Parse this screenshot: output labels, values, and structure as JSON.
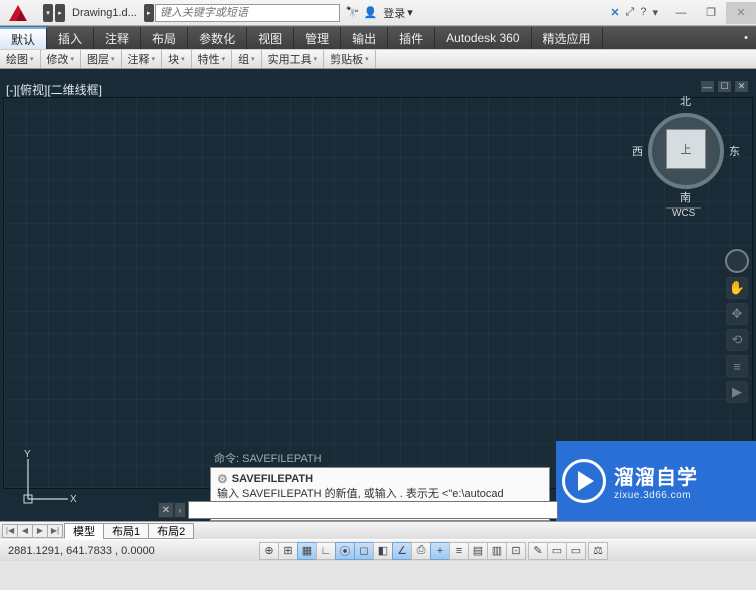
{
  "titlebar": {
    "doc_title": "Drawing1.d...",
    "search_placeholder": "键入关键字或短语",
    "login_label": "登录",
    "dropdown_glyph": "▾"
  },
  "ribbon": {
    "tabs": [
      "默认",
      "插入",
      "注释",
      "布局",
      "参数化",
      "视图",
      "管理",
      "输出",
      "插件",
      "Autodesk 360",
      "精选应用"
    ],
    "bullet": "•"
  },
  "panels": {
    "tabs": [
      "绘图",
      "修改",
      "图层",
      "注释",
      "块",
      "特性",
      "组",
      "实用工具",
      "剪贴板"
    ]
  },
  "view": {
    "label": "[-][俯视][二维线框]",
    "cube_face": "上",
    "north": "北",
    "south": "南",
    "east": "东",
    "west": "西",
    "wcs": "WCS"
  },
  "ucs": {
    "x": "X",
    "y": "Y"
  },
  "command": {
    "history_prefix": "命令:",
    "history_cmd": "SAVEFILEPATH",
    "title": "SAVEFILEPATH",
    "body": "输入 SAVEFILEPATH 的新值, 或输入 . 表示无 <\"e:\\autocad save\">:"
  },
  "watermark": {
    "cn": "溜溜自学",
    "en": "zixue.3d66.com"
  },
  "layout": {
    "tabs": [
      "模型",
      "布局1",
      "布局2"
    ]
  },
  "status": {
    "coords": "2881.1291, 641.7833 , 0.0000"
  },
  "icons": {
    "binoculars": "🔭",
    "person": "👤",
    "exchange": "✕",
    "help": "?",
    "down": "▾",
    "minimize": "—",
    "restore": "❐",
    "close": "✕",
    "first": "|◀",
    "prev": "◀",
    "next": "▶",
    "last": "▶|",
    "gear": "⚙",
    "pan": "✋",
    "orbit": "⟲",
    "menu": "≡",
    "play": "▶"
  }
}
